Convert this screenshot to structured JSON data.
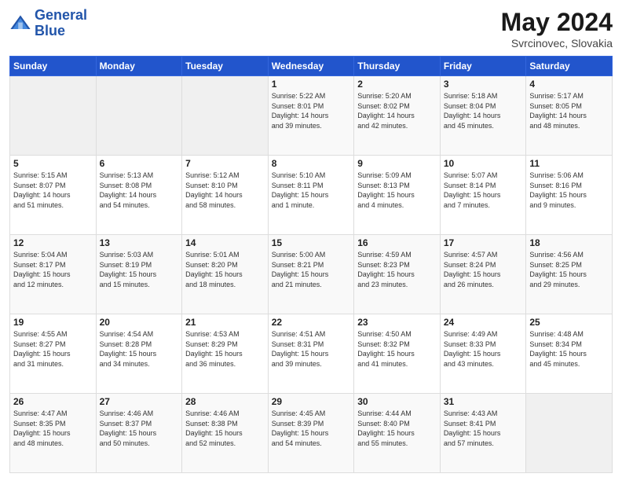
{
  "header": {
    "logo_line1": "General",
    "logo_line2": "Blue",
    "title": "May 2024",
    "subtitle": "Svrcinovec, Slovakia"
  },
  "calendar": {
    "days_of_week": [
      "Sunday",
      "Monday",
      "Tuesday",
      "Wednesday",
      "Thursday",
      "Friday",
      "Saturday"
    ],
    "weeks": [
      [
        {
          "day": "",
          "info": ""
        },
        {
          "day": "",
          "info": ""
        },
        {
          "day": "",
          "info": ""
        },
        {
          "day": "1",
          "info": "Sunrise: 5:22 AM\nSunset: 8:01 PM\nDaylight: 14 hours\nand 39 minutes."
        },
        {
          "day": "2",
          "info": "Sunrise: 5:20 AM\nSunset: 8:02 PM\nDaylight: 14 hours\nand 42 minutes."
        },
        {
          "day": "3",
          "info": "Sunrise: 5:18 AM\nSunset: 8:04 PM\nDaylight: 14 hours\nand 45 minutes."
        },
        {
          "day": "4",
          "info": "Sunrise: 5:17 AM\nSunset: 8:05 PM\nDaylight: 14 hours\nand 48 minutes."
        }
      ],
      [
        {
          "day": "5",
          "info": "Sunrise: 5:15 AM\nSunset: 8:07 PM\nDaylight: 14 hours\nand 51 minutes."
        },
        {
          "day": "6",
          "info": "Sunrise: 5:13 AM\nSunset: 8:08 PM\nDaylight: 14 hours\nand 54 minutes."
        },
        {
          "day": "7",
          "info": "Sunrise: 5:12 AM\nSunset: 8:10 PM\nDaylight: 14 hours\nand 58 minutes."
        },
        {
          "day": "8",
          "info": "Sunrise: 5:10 AM\nSunset: 8:11 PM\nDaylight: 15 hours\nand 1 minute."
        },
        {
          "day": "9",
          "info": "Sunrise: 5:09 AM\nSunset: 8:13 PM\nDaylight: 15 hours\nand 4 minutes."
        },
        {
          "day": "10",
          "info": "Sunrise: 5:07 AM\nSunset: 8:14 PM\nDaylight: 15 hours\nand 7 minutes."
        },
        {
          "day": "11",
          "info": "Sunrise: 5:06 AM\nSunset: 8:16 PM\nDaylight: 15 hours\nand 9 minutes."
        }
      ],
      [
        {
          "day": "12",
          "info": "Sunrise: 5:04 AM\nSunset: 8:17 PM\nDaylight: 15 hours\nand 12 minutes."
        },
        {
          "day": "13",
          "info": "Sunrise: 5:03 AM\nSunset: 8:19 PM\nDaylight: 15 hours\nand 15 minutes."
        },
        {
          "day": "14",
          "info": "Sunrise: 5:01 AM\nSunset: 8:20 PM\nDaylight: 15 hours\nand 18 minutes."
        },
        {
          "day": "15",
          "info": "Sunrise: 5:00 AM\nSunset: 8:21 PM\nDaylight: 15 hours\nand 21 minutes."
        },
        {
          "day": "16",
          "info": "Sunrise: 4:59 AM\nSunset: 8:23 PM\nDaylight: 15 hours\nand 23 minutes."
        },
        {
          "day": "17",
          "info": "Sunrise: 4:57 AM\nSunset: 8:24 PM\nDaylight: 15 hours\nand 26 minutes."
        },
        {
          "day": "18",
          "info": "Sunrise: 4:56 AM\nSunset: 8:25 PM\nDaylight: 15 hours\nand 29 minutes."
        }
      ],
      [
        {
          "day": "19",
          "info": "Sunrise: 4:55 AM\nSunset: 8:27 PM\nDaylight: 15 hours\nand 31 minutes."
        },
        {
          "day": "20",
          "info": "Sunrise: 4:54 AM\nSunset: 8:28 PM\nDaylight: 15 hours\nand 34 minutes."
        },
        {
          "day": "21",
          "info": "Sunrise: 4:53 AM\nSunset: 8:29 PM\nDaylight: 15 hours\nand 36 minutes."
        },
        {
          "day": "22",
          "info": "Sunrise: 4:51 AM\nSunset: 8:31 PM\nDaylight: 15 hours\nand 39 minutes."
        },
        {
          "day": "23",
          "info": "Sunrise: 4:50 AM\nSunset: 8:32 PM\nDaylight: 15 hours\nand 41 minutes."
        },
        {
          "day": "24",
          "info": "Sunrise: 4:49 AM\nSunset: 8:33 PM\nDaylight: 15 hours\nand 43 minutes."
        },
        {
          "day": "25",
          "info": "Sunrise: 4:48 AM\nSunset: 8:34 PM\nDaylight: 15 hours\nand 45 minutes."
        }
      ],
      [
        {
          "day": "26",
          "info": "Sunrise: 4:47 AM\nSunset: 8:35 PM\nDaylight: 15 hours\nand 48 minutes."
        },
        {
          "day": "27",
          "info": "Sunrise: 4:46 AM\nSunset: 8:37 PM\nDaylight: 15 hours\nand 50 minutes."
        },
        {
          "day": "28",
          "info": "Sunrise: 4:46 AM\nSunset: 8:38 PM\nDaylight: 15 hours\nand 52 minutes."
        },
        {
          "day": "29",
          "info": "Sunrise: 4:45 AM\nSunset: 8:39 PM\nDaylight: 15 hours\nand 54 minutes."
        },
        {
          "day": "30",
          "info": "Sunrise: 4:44 AM\nSunset: 8:40 PM\nDaylight: 15 hours\nand 55 minutes."
        },
        {
          "day": "31",
          "info": "Sunrise: 4:43 AM\nSunset: 8:41 PM\nDaylight: 15 hours\nand 57 minutes."
        },
        {
          "day": "",
          "info": ""
        }
      ]
    ]
  }
}
